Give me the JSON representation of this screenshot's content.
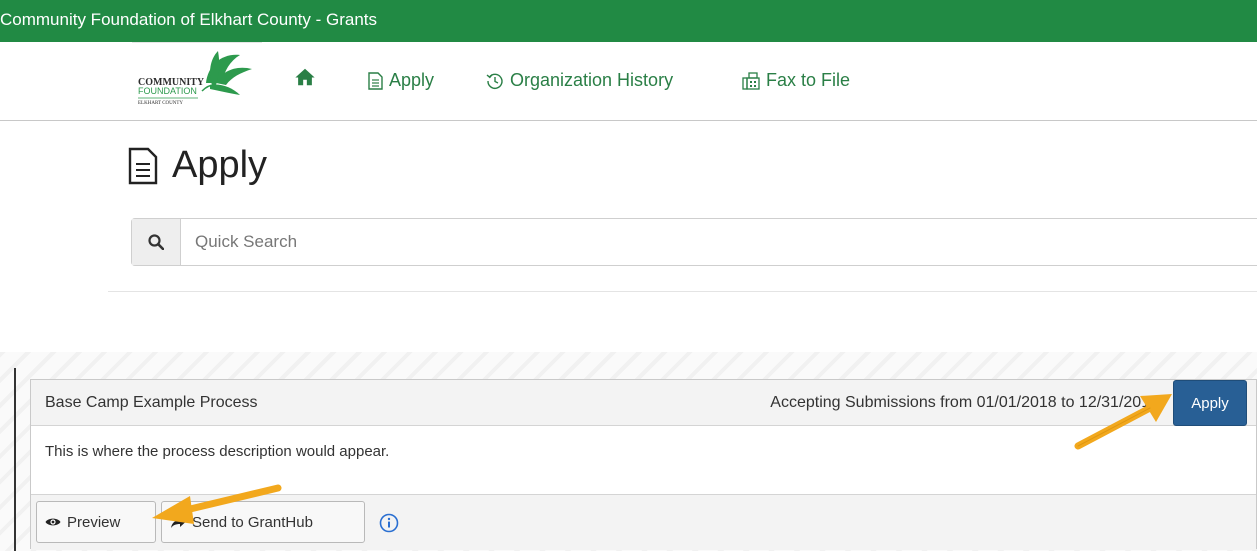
{
  "window": {
    "title": "Community Foundation of Elkhart County - Grants"
  },
  "logo": {
    "line1": "COMMUNITY",
    "line2": "FOUNDATION",
    "line3": "ELKHART COUNTY"
  },
  "nav": {
    "home_icon": "home-icon",
    "items": [
      {
        "label": "Apply",
        "icon": "document-icon"
      },
      {
        "label": "Organization History",
        "icon": "history-icon"
      },
      {
        "label": "Fax to File",
        "icon": "fax-icon"
      }
    ]
  },
  "page": {
    "title": "Apply",
    "title_icon": "document-icon"
  },
  "search": {
    "placeholder": "Quick Search",
    "value": "",
    "icon": "search-icon"
  },
  "process": {
    "name": "Base Camp Example Process",
    "accepting": "Accepting Submissions from 01/01/2018 to 12/31/2018",
    "apply_label": "Apply",
    "description": "This is where the process description would appear.",
    "preview_label": "Preview",
    "send_label": "Send to GrantHub",
    "info_icon": "info-icon"
  },
  "colors": {
    "header": "#218a44",
    "accent": "#2a7f46",
    "primary_button": "#285f95",
    "annotation_arrow": "#f2a81d"
  }
}
